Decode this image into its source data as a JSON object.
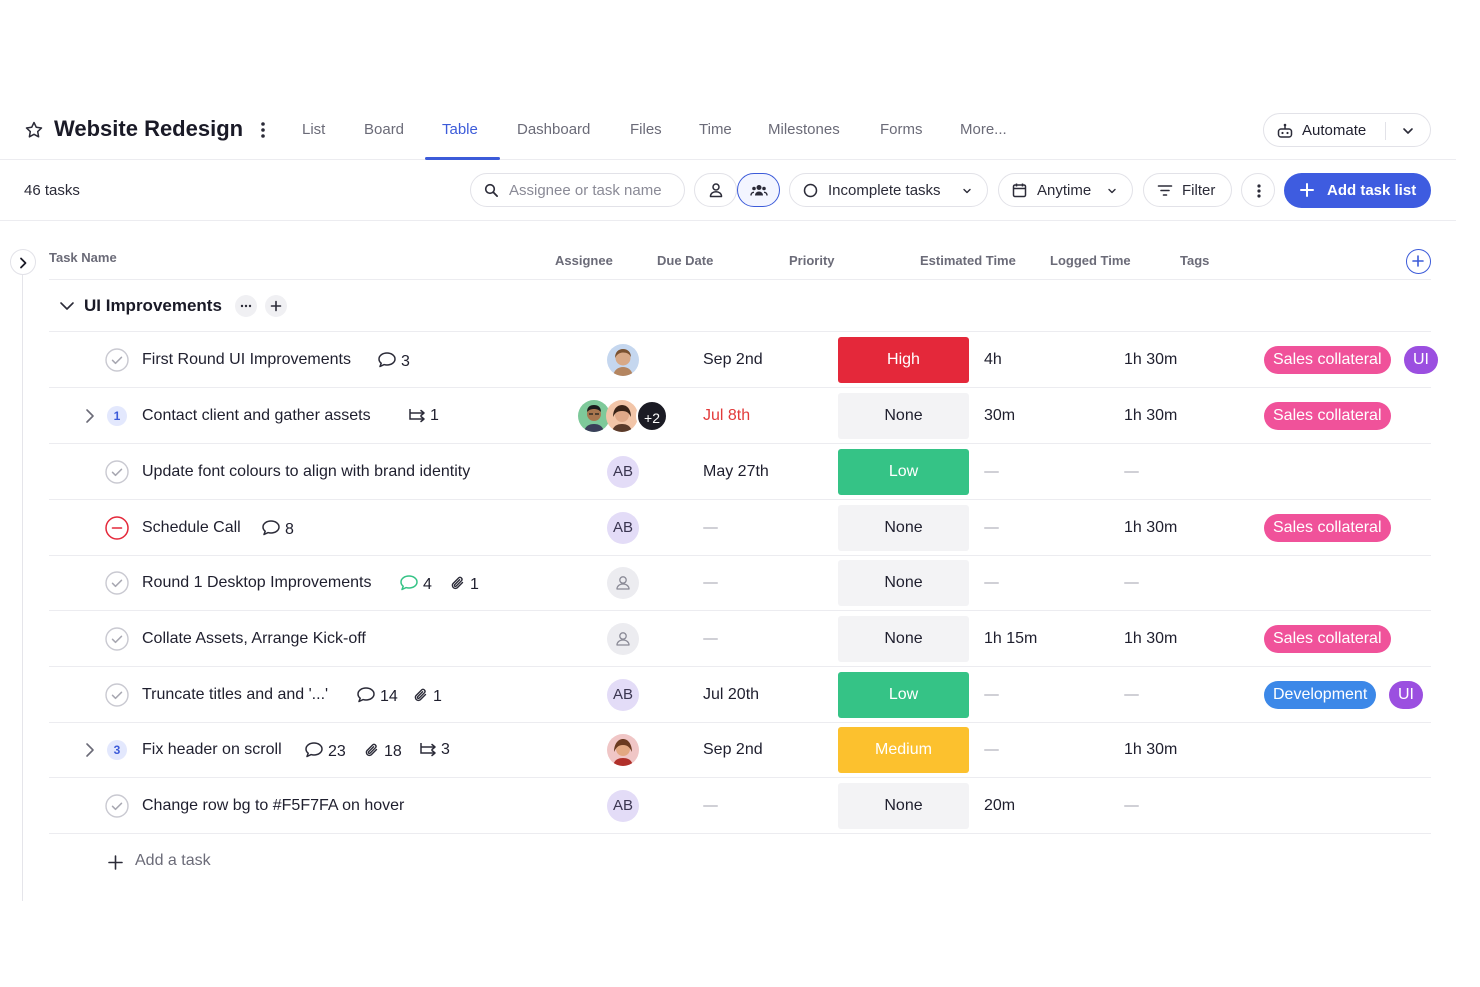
{
  "header": {
    "project_title": "Website Redesign",
    "tabs": [
      {
        "label": "List"
      },
      {
        "label": "Board"
      },
      {
        "label": "Table",
        "active": true
      },
      {
        "label": "Dashboard"
      },
      {
        "label": "Files"
      },
      {
        "label": "Time"
      },
      {
        "label": "Milestones"
      },
      {
        "label": "Forms"
      },
      {
        "label": "More..."
      }
    ],
    "automate_label": "Automate"
  },
  "toolbar": {
    "task_count": "46 tasks",
    "search_placeholder": "Assignee or task name",
    "status_filter": "Incomplete tasks",
    "date_filter": "Anytime",
    "filter_label": "Filter",
    "add_task_list_label": "Add task list"
  },
  "columns": {
    "task_name": "Task Name",
    "assignee": "Assignee",
    "due_date": "Due Date",
    "priority": "Priority",
    "estimated_time": "Estimated Time",
    "logged_time": "Logged Time",
    "tags": "Tags"
  },
  "group": {
    "name": "UI Improvements"
  },
  "tasks": [
    {
      "name": "First Round UI Improvements",
      "comments": "3",
      "assignee": "photo",
      "due": "Sep 2nd",
      "priority": "High",
      "estimated": "4h",
      "logged": "1h 30m",
      "tags": [
        "Sales collateral",
        "UI"
      ]
    },
    {
      "name": "Contact client and gather assets",
      "subtask_count": "1",
      "subtasks": "1",
      "assignee_more": "+2",
      "due": "Jul 8th",
      "due_overdue": true,
      "priority": "None",
      "estimated": "30m",
      "logged": "1h 30m",
      "tags": [
        "Sales collateral"
      ]
    },
    {
      "name": "Update font colours to align with brand identity",
      "assignee": "AB",
      "due": "May 27th",
      "priority": "Low",
      "tags": []
    },
    {
      "name": "Schedule Call",
      "comments": "8",
      "assignee": "AB",
      "priority": "None",
      "logged": "1h 30m",
      "tags": [
        "Sales collateral"
      ]
    },
    {
      "name": "Round 1 Desktop Improvements",
      "comments": "4",
      "attachments": "1",
      "assignee": "unassigned",
      "priority": "None",
      "tags": []
    },
    {
      "name": "Collate Assets, Arrange Kick-off",
      "assignee": "unassigned",
      "priority": "None",
      "estimated": "1h 15m",
      "logged": "1h 30m",
      "tags": [
        "Sales collateral"
      ]
    },
    {
      "name": "Truncate titles and and '...'",
      "comments": "14",
      "attachments": "1",
      "assignee": "AB",
      "due": "Jul 20th",
      "priority": "Low",
      "tags": [
        "Development",
        "UI"
      ]
    },
    {
      "name": "Fix header on scroll",
      "subtask_count": "3",
      "comments": "23",
      "attachments": "18",
      "subtasks": "3",
      "assignee": "photo",
      "due": "Sep 2nd",
      "priority": "Medium",
      "logged": "1h 30m",
      "tags": []
    },
    {
      "name": "Change row bg to #F5F7FA on hover",
      "assignee": "AB",
      "priority": "None",
      "estimated": "20m",
      "tags": []
    }
  ],
  "add_task_label": "Add a task",
  "colors": {
    "accent": "#3c5bd9",
    "high": "#e4283a",
    "low": "#35c386",
    "medium": "#fcc12e",
    "tag_sales": "#f0529a",
    "tag_dev": "#3c88e8",
    "tag_ui": "#9b4fe0",
    "overdue": "#e23b3b"
  }
}
